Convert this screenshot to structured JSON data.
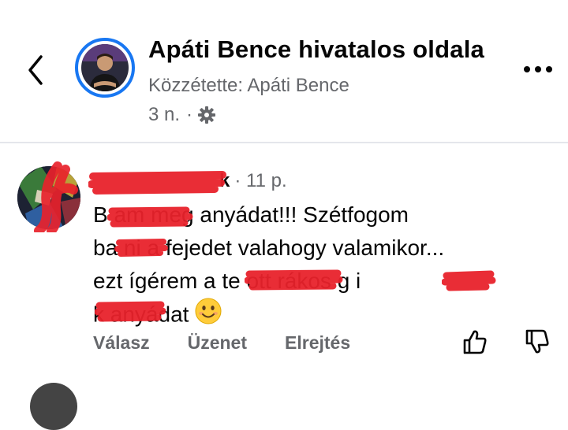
{
  "header": {
    "title": "Apáti Bence hivatalos oldala",
    "posted_by": "Közzétette: Apáti Bence",
    "age": "3 n.",
    "dot": "·",
    "back_icon": "chevron-left-icon",
    "more_icon": "more-dots-icon",
    "privacy_icon": "gear-icon"
  },
  "comment": {
    "author_suffix": "k",
    "separator": "·",
    "time": "11 p.",
    "lines": [
      "B        am meg anyádat!!! Szétfogom",
      "ba      ni a fejedet valahogy valamikor...",
      "ezt ígérem a te            ott rákos g   i",
      "k        anyádat"
    ],
    "emoji": "smiling-face-icon",
    "actions": {
      "reply": "Válasz",
      "message": "Üzenet",
      "hide": "Elrejtés"
    },
    "like_icon": "thumbs-up-icon",
    "dislike_icon": "thumbs-down-icon"
  },
  "colors": {
    "accent": "#1877f2",
    "secondary_text": "#65676b",
    "redaction": "#e8222b"
  }
}
